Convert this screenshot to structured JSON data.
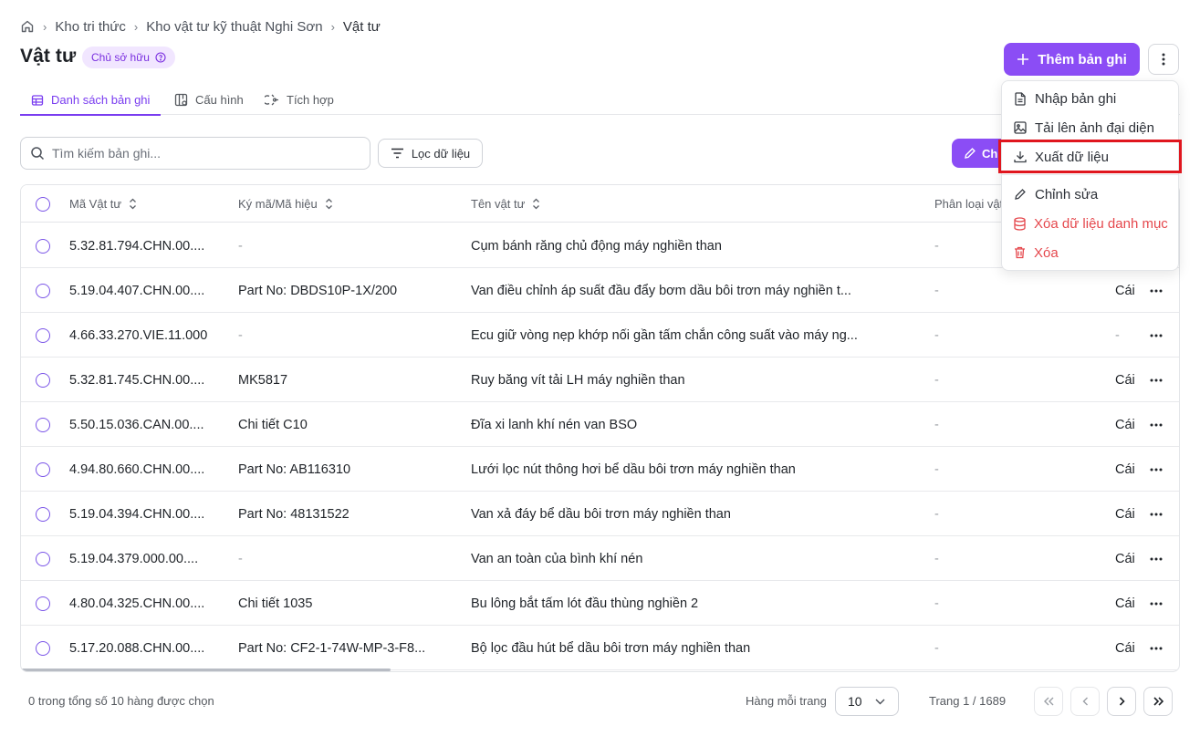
{
  "breadcrumb": {
    "items": [
      "Kho tri thức",
      "Kho vật tư kỹ thuật Nghi Sơn"
    ],
    "current": "Vật tư"
  },
  "page": {
    "title": "Vật tư",
    "badge": "Chủ sở hữu"
  },
  "tabs": [
    {
      "label": "Danh sách bản ghi",
      "icon": "table-icon",
      "active": true
    },
    {
      "label": "Cấu hình",
      "icon": "columns-config-icon",
      "active": false
    },
    {
      "label": "Tích hợp",
      "icon": "integration-icon",
      "active": false
    }
  ],
  "toolbar": {
    "add_label": "Thêm bản ghi",
    "search_placeholder": "Tìm kiếm bản ghi...",
    "filter_label": "Lọc dữ liệu",
    "edit_label_partial": "Ch"
  },
  "table": {
    "columns": [
      "Mã Vật tư",
      "Ký mã/Mã hiệu",
      "Tên vật tư",
      "Phân loại vật"
    ],
    "rows": [
      {
        "code": "5.32.81.794.CHN.00....",
        "model": "-",
        "name": "Cụm bánh răng chủ động máy nghiền than",
        "category": "-",
        "unit": ""
      },
      {
        "code": "5.19.04.407.CHN.00....",
        "model": "Part No: DBDS10P-1X/200",
        "name": "Van điều chỉnh áp suất đầu đẩy bơm dầu bôi trơn máy nghiền t...",
        "category": "-",
        "unit": "Cái"
      },
      {
        "code": "4.66.33.270.VIE.11.000",
        "model": "-",
        "name": "Ecu giữ vòng nẹp khớp nối gần tấm chắn công suất vào máy ng...",
        "category": "-",
        "unit": "-"
      },
      {
        "code": "5.32.81.745.CHN.00....",
        "model": "MK5817",
        "name": "Ruy băng vít tải LH máy nghiền than",
        "category": "-",
        "unit": "Cái"
      },
      {
        "code": "5.50.15.036.CAN.00....",
        "model": "Chi tiết C10",
        "name": "Đĩa xi lanh khí nén van BSO",
        "category": "-",
        "unit": "Cái"
      },
      {
        "code": "4.94.80.660.CHN.00....",
        "model": "Part No: AB116310",
        "name": "Lưới lọc nút thông hơi bể dầu bôi trơn máy nghiền than",
        "category": "-",
        "unit": "Cái"
      },
      {
        "code": "5.19.04.394.CHN.00....",
        "model": "Part No: 48131522",
        "name": "Van xả đáy bể dầu bôi trơn máy nghiền than",
        "category": "-",
        "unit": "Cái"
      },
      {
        "code": "5.19.04.379.000.00....",
        "model": "-",
        "name": "Van an toàn của bình khí nén",
        "category": "-",
        "unit": "Cái"
      },
      {
        "code": "4.80.04.325.CHN.00....",
        "model": "Chi tiết 1035",
        "name": "Bu lông bắt tấm lót đầu thùng nghiền 2",
        "category": "-",
        "unit": "Cái"
      },
      {
        "code": "5.17.20.088.CHN.00....",
        "model": "Part No: CF2-1-74W-MP-3-F8...",
        "name": "Bộ lọc đầu hút bể dầu bôi trơn máy nghiền than",
        "category": "-",
        "unit": "Cái"
      }
    ]
  },
  "footer": {
    "selection": "0 trong tổng số 10 hàng được chọn",
    "rows_per_page_label": "Hàng mỗi trang",
    "rows_per_page_value": "10",
    "page_info": "Trang 1 / 1689"
  },
  "menu": {
    "items": [
      {
        "label": "Nhập bản ghi",
        "icon": "file-import-icon",
        "danger": false
      },
      {
        "label": "Tải lên ảnh đại diện",
        "icon": "image-icon",
        "danger": false
      },
      {
        "label": "Xuất dữ liệu",
        "icon": "download-icon",
        "danger": false,
        "highlighted": true
      },
      {
        "label": "Chỉnh sửa",
        "icon": "pencil-icon",
        "danger": false
      },
      {
        "label": "Xóa dữ liệu danh mục",
        "icon": "database-icon",
        "danger": true
      },
      {
        "label": "Xóa",
        "icon": "trash-icon",
        "danger": true
      }
    ]
  },
  "colors": {
    "accent": "#8b4df5",
    "danger": "#e5484d",
    "highlight": "#e0161e"
  }
}
